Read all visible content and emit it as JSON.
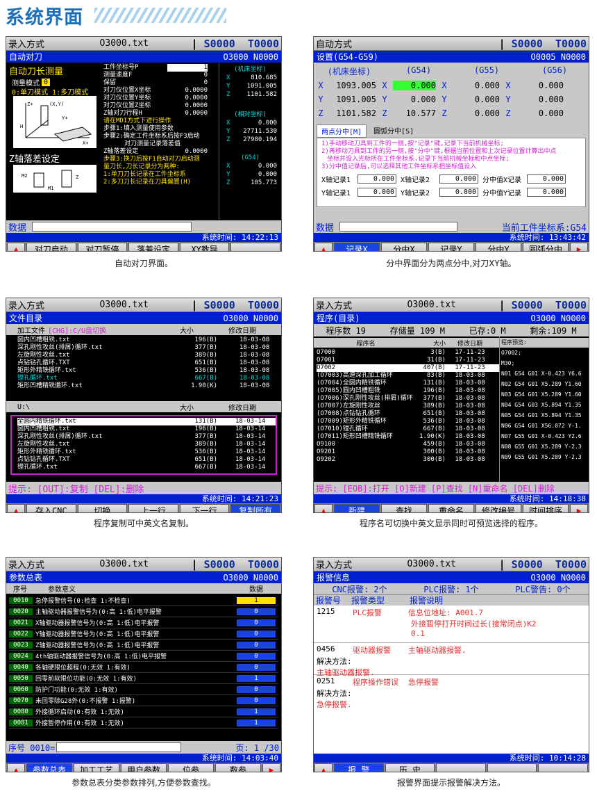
{
  "page": {
    "title": "系统界面"
  },
  "common": {
    "s": "S0000",
    "t": "T0000",
    "file": "O3000.txt",
    "data_label": "数据"
  },
  "p1": {
    "mode": "录入方式",
    "title": "自动对刀",
    "prog": "O3000 N0000",
    "tool_len": "自动刀长测量",
    "meas_mode_label": "测量模式",
    "meas_mode_val": "0",
    "mode_desc": "0:单刀模式 1:多刀模式",
    "params": [
      {
        "l": "工件坐标号P",
        "v": "1"
      },
      {
        "l": "测量速度F",
        "v": "0"
      },
      {
        "l": "保留",
        "v": "0"
      },
      {
        "l": "对刀仪位置X坐标",
        "v": "0.0000"
      },
      {
        "l": "对刀仪位置Y坐标",
        "v": "0.0000"
      },
      {
        "l": "对刀仪位置Z坐标",
        "v": "0.0000"
      },
      {
        "l": "Z轴对刀行程H",
        "v": "0.0000"
      }
    ],
    "steps": [
      "请在MDI方式下进行操作",
      "步骤1:填入测量使用参数",
      "步骤2:确定工件坐标系后按F3启动",
      "对刀测量记录落差值"
    ],
    "z_title": "Z轴落差设定",
    "z_label": "Z轴落差设定",
    "z_val": "0.0000",
    "steps2": [
      "步骤3:换刀后按F1自动对刀启动测",
      "量刀长,刀长记录分为两种:",
      "1:单刀刀长记录在工件坐标系",
      "2:多刀刀长记录在刀具偏置(H)"
    ],
    "mach_title": "(机床坐标)",
    "mach": [
      {
        "a": "X",
        "v": "810.685"
      },
      {
        "a": "Y",
        "v": "1091.005"
      },
      {
        "a": "Z",
        "v": "1101.582"
      }
    ],
    "rel_title": "(相对坐标)",
    "rel": [
      {
        "a": "X",
        "v": "0.000"
      },
      {
        "a": "Y",
        "v": "27711.530"
      },
      {
        "a": "Z",
        "v": "27980.194"
      }
    ],
    "g54_title": "(G54)",
    "g54": [
      {
        "a": "X",
        "v": "0.000"
      },
      {
        "a": "Y",
        "v": "0.000"
      },
      {
        "a": "Z",
        "v": "105.773"
      }
    ],
    "time": "系统时间: 14:22:13",
    "keys": [
      "对刀启动",
      "对刀暂停",
      "落差设定",
      "XY教导",
      ""
    ],
    "caption": "自动对刀界面。"
  },
  "p2": {
    "mode": "自动方式",
    "title": "设置(G54-G59)",
    "prog": "O0005 N0000",
    "cols": [
      "(机床坐标)",
      "(G54)",
      "(G55)",
      "(G56)"
    ],
    "rows": [
      {
        "a": "X",
        "m": "1093.005",
        "g54": "0.000",
        "g55": "0.000",
        "g56": "0.000"
      },
      {
        "a": "Y",
        "m": "1091.005",
        "g54": "0.000",
        "g55": "0.000",
        "g56": "0.000"
      },
      {
        "a": "Z",
        "m": "1101.582",
        "g54": "10.577",
        "g55": "0.000",
        "g56": "0.000"
      }
    ],
    "tab1": "两点分中[M]",
    "tab2": "圆弧分中[S]",
    "notes": [
      "1)手动移动刀具到工件的一侧,按\"记录\"键,记录下当前机械坐标;",
      "2)再移动刀具到工件的另一侧,按\"分中\"键,根据当前位置和上次记录位置计算出中点",
      "坐标并设入光标所在工件坐标系,记录下当前机械坐标和中点坐标;",
      "3)分中值记录后,可以选择其他工件坐标系把坐标值设入"
    ],
    "rec": [
      {
        "l1": "X轴记录1",
        "v1": "0.000",
        "l2": "X轴记录2",
        "v2": "0.000",
        "l3": "分中值X记录",
        "v3": "0.000"
      },
      {
        "l1": "Y轴记录1",
        "v1": "0.000",
        "l2": "Y轴记录2",
        "v2": "0.000",
        "l3": "分中值Y记录",
        "v3": "0.000"
      }
    ],
    "cur_sys": "当前工件坐标系:G54",
    "time": "系统时间: 13:43:42",
    "keys": [
      "记录X",
      "分中X",
      "记录Y",
      "分中Y",
      "圆弧分中"
    ],
    "caption": "分中界面分为两点分中,对刀XY轴。"
  },
  "p3": {
    "mode": "录入方式",
    "title": "文件目录",
    "prog": "O3000 N0000",
    "h1": [
      "加工文件",
      "[CHG]:C/U盘切换",
      "大小",
      "修改日期"
    ],
    "f1": [
      {
        "n": "圆内凹槽粗铣.txt",
        "s": "196(B)",
        "d": "18-03-08"
      },
      {
        "n": "深孔刚性攻丝(排屑)循环.txt",
        "s": "377(B)",
        "d": "18-03-08"
      },
      {
        "n": "左旋刚性攻丝.txt",
        "s": "389(B)",
        "d": "18-03-08"
      },
      {
        "n": "点钻钻孔循环.TXT",
        "s": "651(B)",
        "d": "18-03-08"
      },
      {
        "n": "矩形外精铣循环.txt",
        "s": "536(B)",
        "d": "18-03-08"
      },
      {
        "n": "镗孔循环.txt",
        "s": "667(B)",
        "d": "18-03-08"
      },
      {
        "n": "矩形凹槽精铣循环.txt",
        "s": "1.90(K)",
        "d": "18-03-08"
      }
    ],
    "h2": [
      "U:\\",
      "大小",
      "修改日期"
    ],
    "f2": [
      {
        "n": "全圆内精铣循环.txt",
        "s": "131(B)",
        "d": "18-03-14"
      },
      {
        "n": "圆内凹槽粗铣.txt",
        "s": "196(B)",
        "d": "18-03-14"
      },
      {
        "n": "深孔刚性攻丝(排屑)循环.txt",
        "s": "377(B)",
        "d": "18-03-14"
      },
      {
        "n": "左旋刚性攻丝.txt",
        "s": "389(B)",
        "d": "18-03-14"
      },
      {
        "n": "矩形外精铣循环.txt",
        "s": "536(B)",
        "d": "18-03-14"
      },
      {
        "n": "点钻钻孔循环.TXT",
        "s": "651(B)",
        "d": "18-03-14"
      },
      {
        "n": "镗孔循环.txt",
        "s": "667(B)",
        "d": "18-03-14"
      }
    ],
    "hint": "提示: [OUT]:复制 [DEL]:删除",
    "time": "系统时间: 14:21:23",
    "keys": [
      "存入CNC",
      "切换",
      "上一行",
      "下一行",
      "复制所有"
    ],
    "caption": "程序复制可中英文名复制。"
  },
  "p4": {
    "mode": "录入方式",
    "title": "程序(目录)",
    "prog": "O3000 N0000",
    "stats": [
      "程序数 19",
      "存储量 109 M",
      "已存:0 M",
      "剩余:109 M"
    ],
    "h": [
      "程序名",
      "大小",
      "修改日期",
      "程序预览:"
    ],
    "progs": [
      {
        "n": "O7000",
        "s": "3(B)",
        "d": "17-11-23"
      },
      {
        "n": "O7001",
        "s": "31(B)",
        "d": "17-11-23"
      },
      {
        "n": "O7002",
        "s": "407(B)",
        "d": "17-11-23"
      },
      {
        "n": "(O7003)高速深孔加工循环",
        "s": "83(B)",
        "d": "18-03-08"
      },
      {
        "n": "(O7004)全圆内精铣循环",
        "s": "131(B)",
        "d": "18-03-08"
      },
      {
        "n": "(O7005)圆内凹槽粗铣",
        "s": "196(B)",
        "d": "18-03-08"
      },
      {
        "n": "(O7006)深孔刚性攻丝(排屑)循环",
        "s": "377(B)",
        "d": "18-03-08"
      },
      {
        "n": "(O7007)左旋刚性攻丝",
        "s": "389(B)",
        "d": "18-03-08"
      },
      {
        "n": "(O7008)点钻钻孔循环",
        "s": "651(B)",
        "d": "18-03-08"
      },
      {
        "n": "(O7009)矩形外精铣循环",
        "s": "536(B)",
        "d": "18-03-08"
      },
      {
        "n": "(O7010)镗孔循环",
        "s": "667(B)",
        "d": "18-03-08"
      },
      {
        "n": "(O7011)矩形凹槽精铣循环",
        "s": "1.90(K)",
        "d": "18-03-08"
      },
      {
        "n": "O9100",
        "s": "459(B)",
        "d": "18-03-08"
      },
      {
        "n": "O9201",
        "s": "300(B)",
        "d": "18-03-08"
      },
      {
        "n": "O9202",
        "s": "300(B)",
        "d": "18-03-08"
      }
    ],
    "preview": [
      "O7002;",
      "M30;",
      "N01 G54 G01 X-0.423 Y6.6",
      "N02 G54 G01 X5.289 Y1.60",
      "N03 G54 G01 X5.289 Y1.60",
      "N04 G54 G03 X5.894 Y1.35",
      "N05 G54 G01 X5.894 Y1.35",
      "N06 G54 G01 X56.072 Y-1.",
      "N07 G55 G01 X-0.423 Y2.6",
      "N08 G55 G01 X5.289 Y-2.3",
      "N09 G55 G01 X5.289 Y-2.3"
    ],
    "hint": "提示: [EOB]:打开 [O]新建 [P]查找 [N]重命名 [DEL]删除",
    "time": "系统时间: 14:18:38",
    "keys": [
      "新建",
      "查找",
      "重命名",
      "修改编号",
      "时间排序"
    ],
    "caption": "程序名可切换中英文显示同时可预览选择的程序。"
  },
  "p5": {
    "mode": "录入方式",
    "title": "参数总表",
    "prog": "O3000 N0000",
    "h": [
      "序号",
      "参数意义",
      "数据"
    ],
    "rows": [
      {
        "n": "0010",
        "m": "急停报警信号(0:检查 1:不检查)",
        "v": "1"
      },
      {
        "n": "0020",
        "m": "主轴驱动器报警信号为(0:高 1:低)电平报警",
        "v": "0"
      },
      {
        "n": "0021",
        "m": "X轴驱动器报警信号为(0:高 1:低)电平报警",
        "v": "0"
      },
      {
        "n": "0022",
        "m": "Y轴驱动器报警信号为(0:高 1:低)电平报警",
        "v": "0"
      },
      {
        "n": "0023",
        "m": "Z轴驱动器报警信号为(0:高 1:低)电平报警",
        "v": "0"
      },
      {
        "n": "0024",
        "m": "4th轴驱动器报警信号为(0:高 1:低)电平报警",
        "v": "0"
      },
      {
        "n": "0040",
        "m": "各轴硬限位超程(0:无效 1:有效)",
        "v": "0"
      },
      {
        "n": "0050",
        "m": "回零前软限位功能(0:无效 1:有效)",
        "v": "1"
      },
      {
        "n": "0060",
        "m": "防护门功能(0:无效 1:有效)",
        "v": "0"
      },
      {
        "n": "0070",
        "m": "未回零除G28外(0:不报警 1:报警)",
        "v": "0"
      },
      {
        "n": "0080",
        "m": "外接循环启动(0:有效 1:无效)",
        "v": "1"
      },
      {
        "n": "0081",
        "m": "外接暂停作用(0:有效 1:无效)",
        "v": "1"
      }
    ],
    "seq_label": "序号 0010=",
    "page_label": "页: 1 /30",
    "time": "系统时间: 14:03:40",
    "keys": [
      "参数总表",
      "加工工艺",
      "用户参数",
      "位参",
      "数参"
    ],
    "caption": "参数总表分类参数排列,方便参数查找。"
  },
  "p6": {
    "mode": "录入方式",
    "title": "报警信息",
    "prog": "O3000 N0000",
    "counts": [
      "CNC报警: 2个",
      "PLC报警: 1个",
      "PLC警告: 0个"
    ],
    "h": [
      "报警号",
      "报警类型",
      "报警说明"
    ],
    "a1": {
      "n": "1215",
      "t": "PLC报警",
      "d1": "信息位地址: A001.7",
      "d2": "外接暂停打开时间过长(接常闭点)K2",
      "d3": "0.1"
    },
    "a2": {
      "n": "0456",
      "t": "驱动器报警",
      "d": "主轴驱动器报警.",
      "sl": "解决方法:",
      "sol": "主轴驱动器报警."
    },
    "a3": {
      "n": "0251",
      "t": "程序操作错误",
      "d": "急停报警",
      "sl": "解决方法:",
      "sol": "急停报警."
    },
    "time": "系统时间: 10:14:28",
    "keys": [
      "报 警",
      "历 史",
      "",
      "",
      ""
    ],
    "caption": "报警界面提示报警解决方法。"
  }
}
